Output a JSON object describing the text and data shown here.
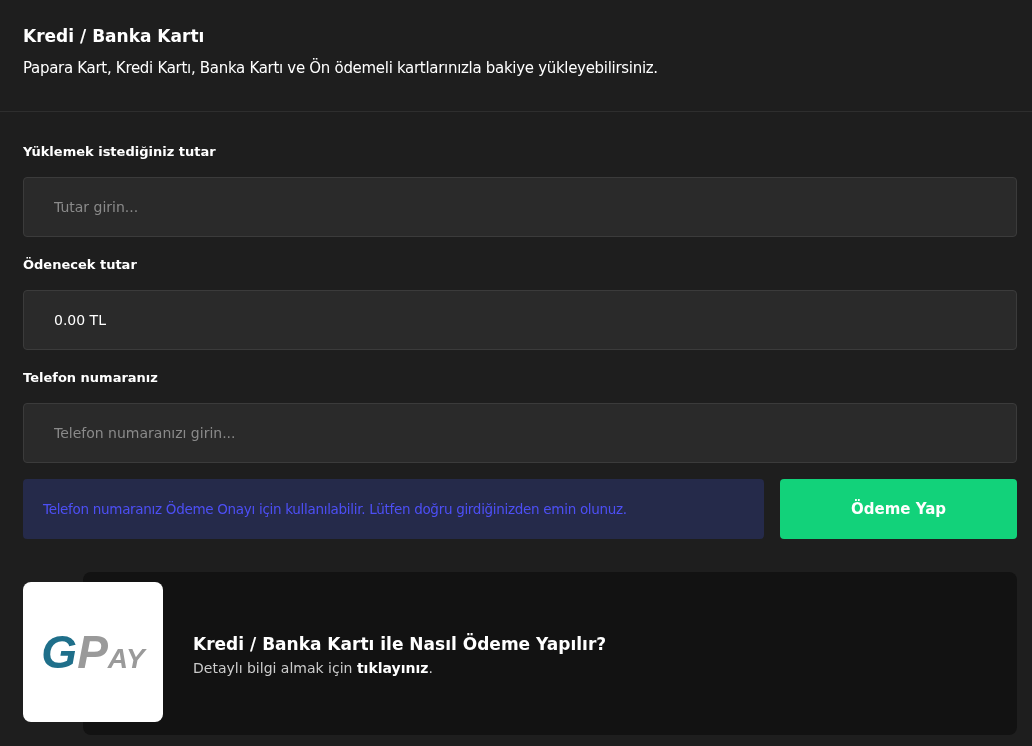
{
  "header": {
    "title": "Kredi / Banka Kartı",
    "subtitle": "Papara Kart, Kredi Kartı, Banka Kartı ve Ön ödemeli kartlarınızla bakiye yükleyebilirsiniz."
  },
  "fields": [
    {
      "label": "Yüklemek istediğiniz tutar",
      "placeholder": "Tutar girin..."
    },
    {
      "label": "Ödenecek tutar",
      "value": "0.00 TL"
    },
    {
      "label": "Telefon numaranız",
      "placeholder": "Telefon numaranızı girin..."
    }
  ],
  "notice": "Telefon numaranız Ödeme Onayı için kullanılabilir. Lütfen doğru girdiğinizden emin olunuz.",
  "pay_button": "Ödeme Yap",
  "info_card": {
    "logo": [
      "G",
      "P",
      "AY"
    ],
    "title": "Kredi / Banka Kartı ile Nasıl Ödeme Yapılır?",
    "text_before": "Detaylı bilgi almak için",
    "link": "tıklayınız",
    "text_after": "."
  }
}
